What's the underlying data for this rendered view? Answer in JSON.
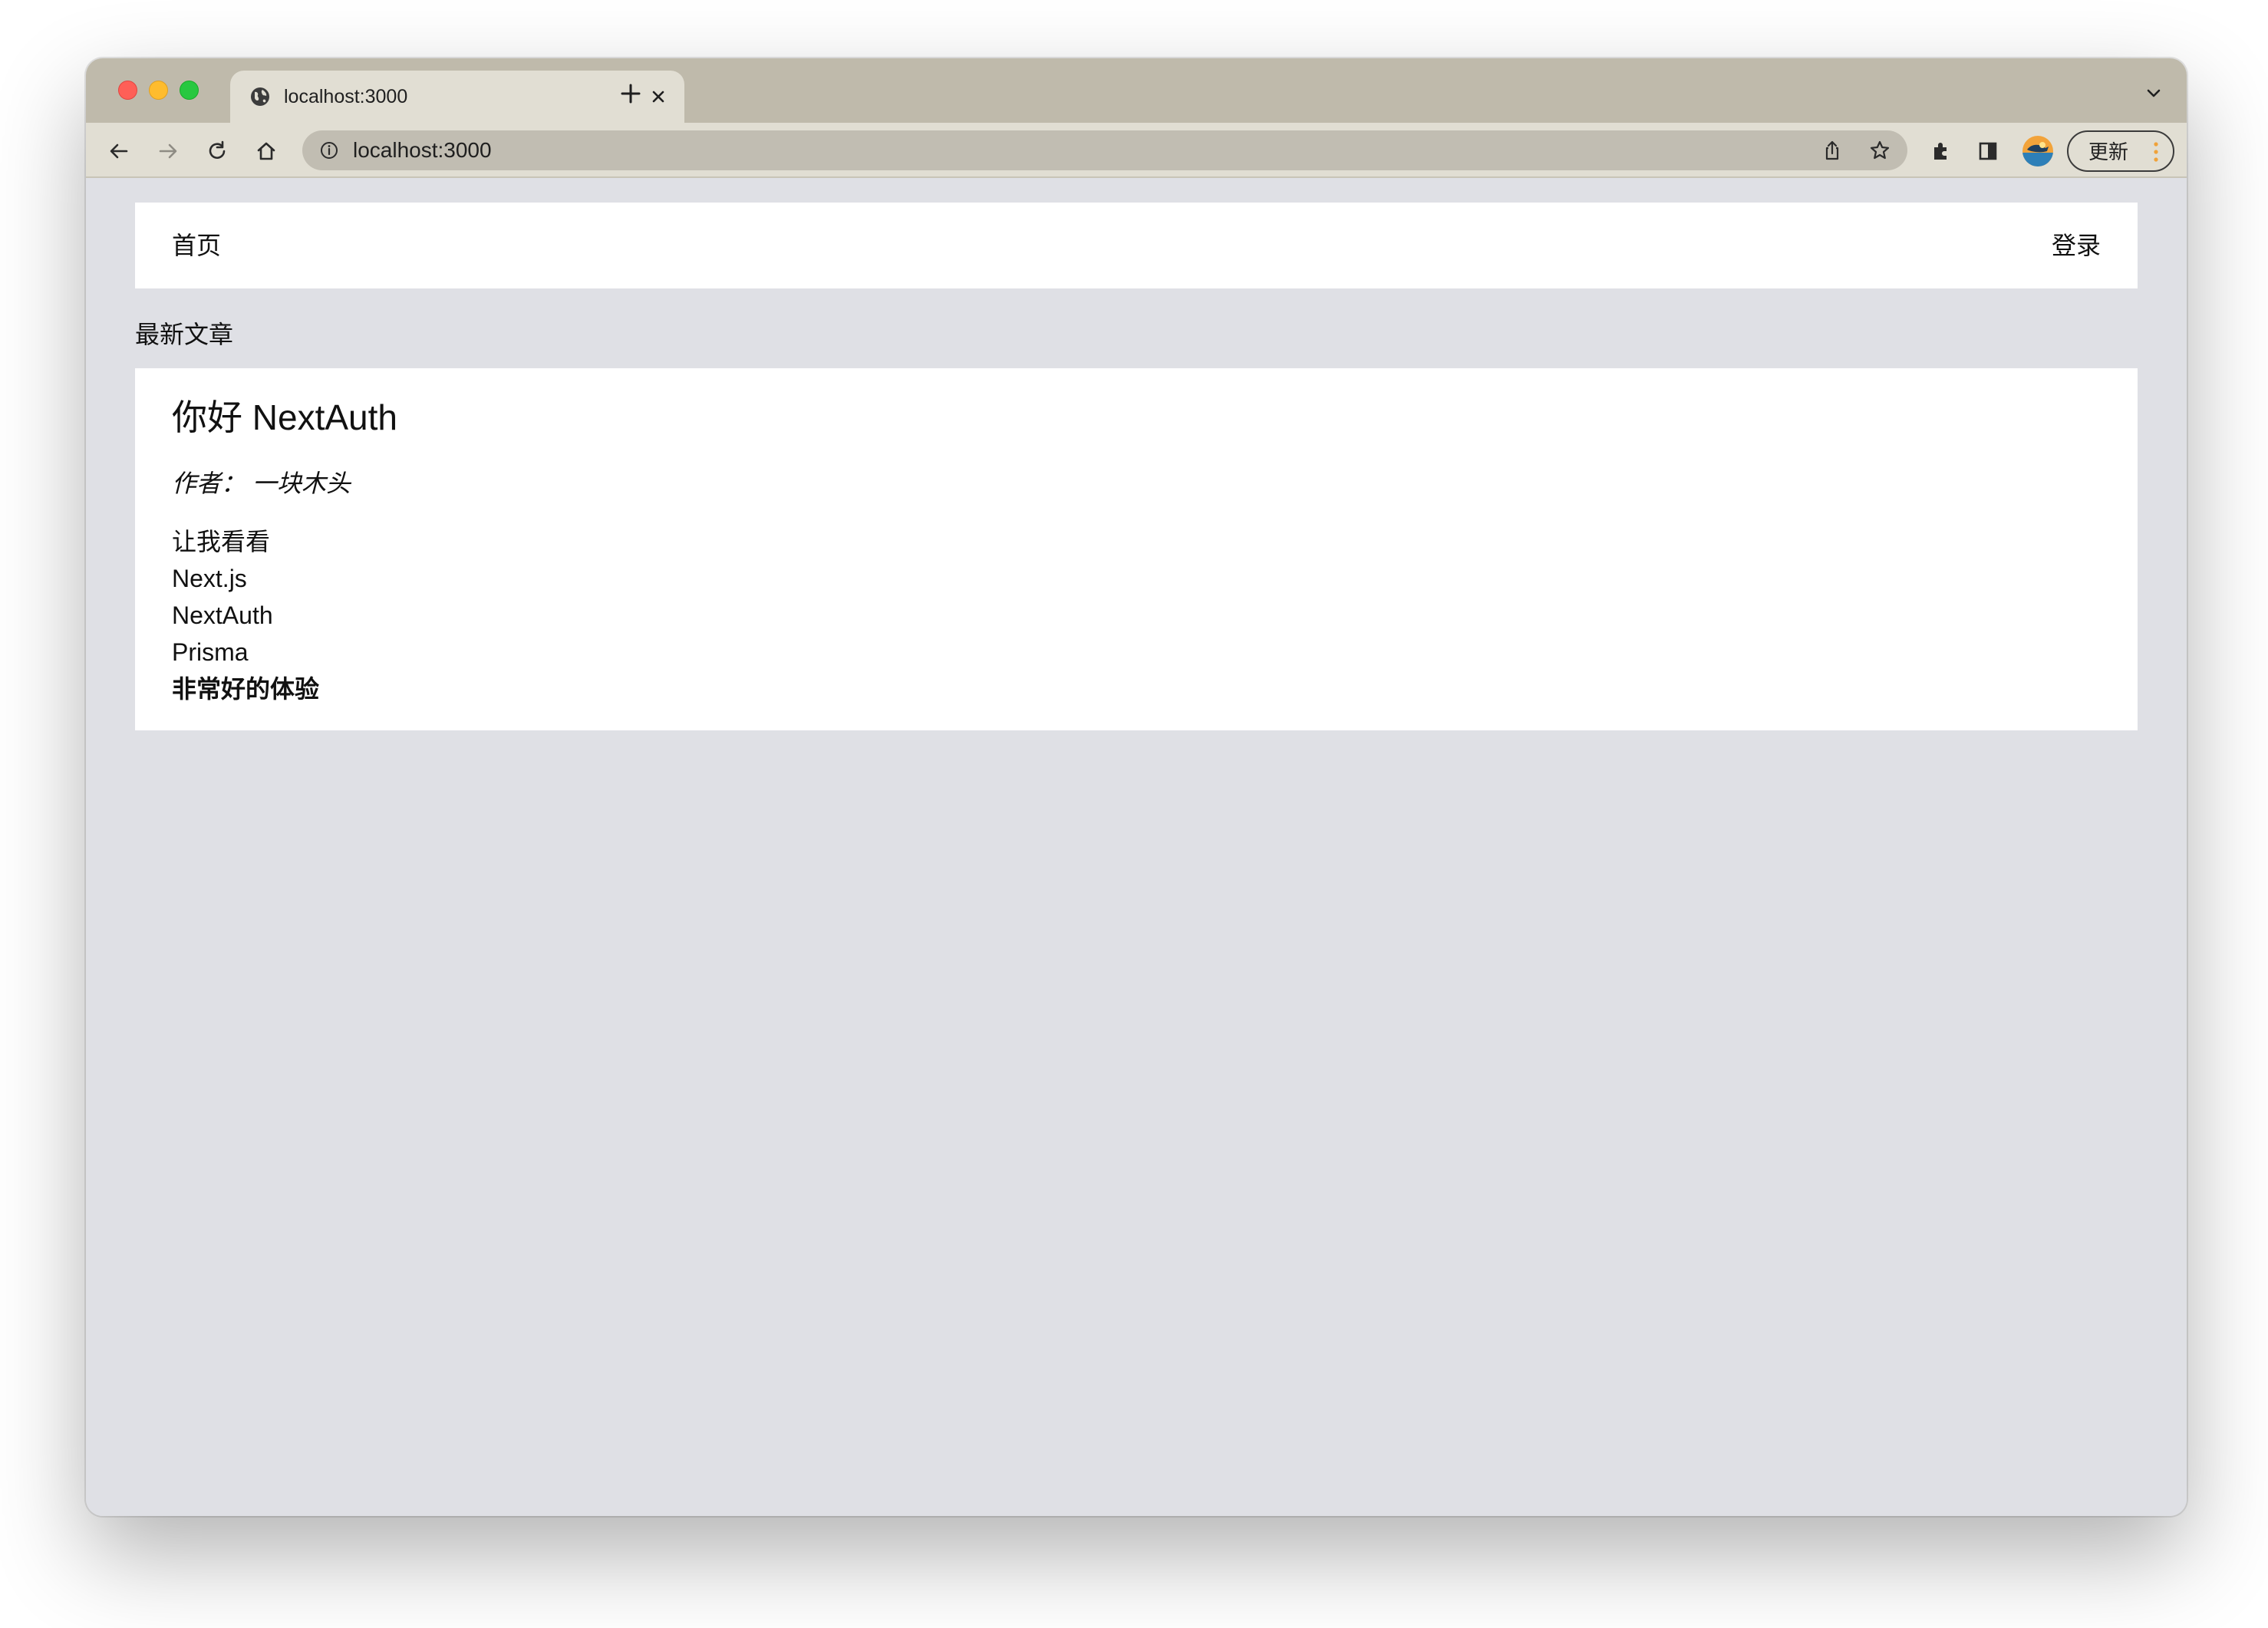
{
  "browser": {
    "tab": {
      "title": "localhost:3000",
      "favicon": "globe-icon"
    },
    "address_bar": {
      "url": "localhost:3000"
    },
    "update_button_label": "更新",
    "colors": {
      "tabstrip": "#bfbaab",
      "toolbar": "#e1ded3",
      "omnibox": "#c1bdb2",
      "page_background": "#dfe0e5"
    }
  },
  "navbar": {
    "home_label": "首页",
    "login_label": "登录"
  },
  "section": {
    "heading": "最新文章"
  },
  "posts": [
    {
      "title": "你好 NextAuth",
      "author_line": "作者：  一块木头",
      "body_lines": [
        {
          "text": "让我看看",
          "bold": false
        },
        {
          "text": "Next.js",
          "bold": false
        },
        {
          "text": "NextAuth",
          "bold": false
        },
        {
          "text": "Prisma",
          "bold": false
        },
        {
          "text": "非常好的体验",
          "bold": true
        }
      ]
    }
  ]
}
